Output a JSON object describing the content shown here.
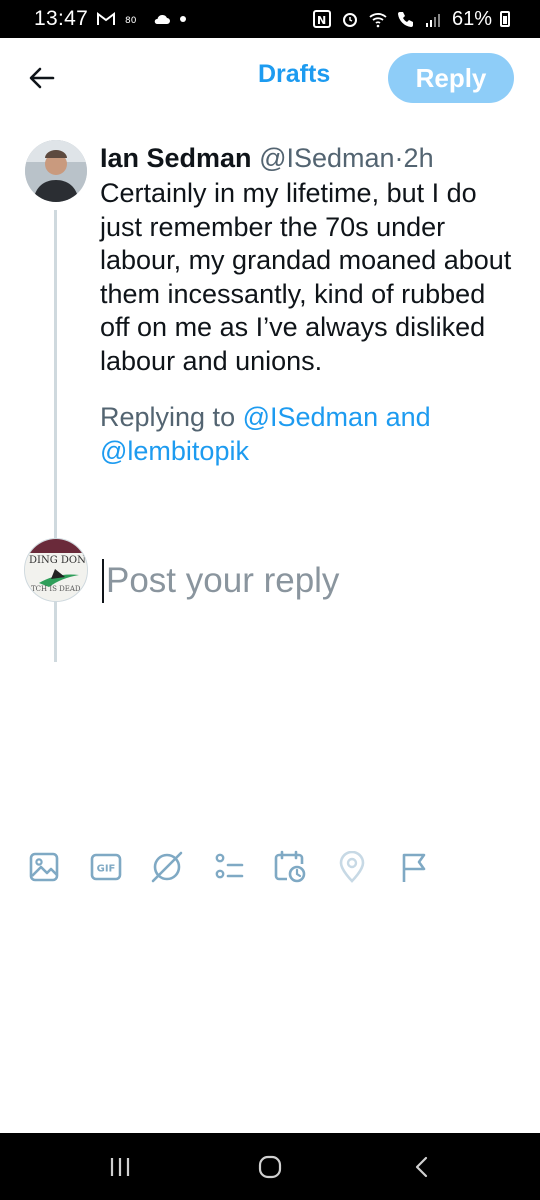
{
  "status_bar": {
    "time": "13:47",
    "battery": "61%",
    "left_icons": [
      "gmail-icon",
      "signal-app-icon",
      "cloud-icon",
      "dot-icon"
    ],
    "right_icons": [
      "nfc-icon",
      "alarm-icon",
      "wifi-icon",
      "call-icon",
      "signal-bars-icon",
      "battery-icon"
    ]
  },
  "header": {
    "back_icon": "arrow-left-icon",
    "drafts_label": "Drafts",
    "reply_label": "Reply"
  },
  "tweet": {
    "name": "Ian Sedman",
    "handle": "@ISedman",
    "separator": "·",
    "time": "2h",
    "text": "Certainly in my lifetime, but I do just remember the 70s under labour, my grandad moaned about them incessantly, kind of rubbed off on me as I’ve always disliked labour and unions.",
    "replying_prefix": "Replying to",
    "replying_user1": "@ISedman",
    "replying_and": "and",
    "replying_user2": "@lembitopik"
  },
  "compose": {
    "placeholder": "Post your reply"
  },
  "toolbar": {
    "items": [
      "image-icon",
      "gif-icon",
      "grok-icon",
      "poll-icon",
      "schedule-icon",
      "location-icon",
      "flag-icon"
    ],
    "gif_label": "GIF"
  },
  "nav_bar": {
    "items": [
      "recent-apps-icon",
      "home-icon",
      "back-icon"
    ]
  },
  "colors": {
    "accent": "#1d9bf0",
    "reply_button_disabled": "#8ecdf8",
    "secondary_text": "#536471",
    "icon_color": "#7fa9c4"
  }
}
